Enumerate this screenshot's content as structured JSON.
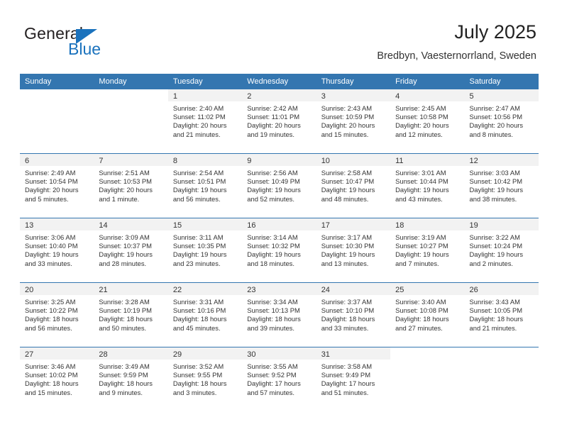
{
  "brand": {
    "name_part1": "General",
    "name_part2": "Blue"
  },
  "header": {
    "title": "July 2025",
    "subtitle": "Bredbyn, Vaesternorrland, Sweden"
  },
  "colors": {
    "header_blue": "#3476b0",
    "logo_blue": "#1a72bd",
    "daynum_band": "#f2f2f2",
    "text": "#333333"
  },
  "weekdays": [
    "Sunday",
    "Monday",
    "Tuesday",
    "Wednesday",
    "Thursday",
    "Friday",
    "Saturday"
  ],
  "weeks": [
    [
      {
        "day": "",
        "sunrise": "",
        "sunset": "",
        "daylight_line1": "",
        "daylight_line2": ""
      },
      {
        "day": "",
        "sunrise": "",
        "sunset": "",
        "daylight_line1": "",
        "daylight_line2": ""
      },
      {
        "day": "1",
        "sunrise": "Sunrise: 2:40 AM",
        "sunset": "Sunset: 11:02 PM",
        "daylight_line1": "Daylight: 20 hours",
        "daylight_line2": "and 21 minutes."
      },
      {
        "day": "2",
        "sunrise": "Sunrise: 2:42 AM",
        "sunset": "Sunset: 11:01 PM",
        "daylight_line1": "Daylight: 20 hours",
        "daylight_line2": "and 19 minutes."
      },
      {
        "day": "3",
        "sunrise": "Sunrise: 2:43 AM",
        "sunset": "Sunset: 10:59 PM",
        "daylight_line1": "Daylight: 20 hours",
        "daylight_line2": "and 15 minutes."
      },
      {
        "day": "4",
        "sunrise": "Sunrise: 2:45 AM",
        "sunset": "Sunset: 10:58 PM",
        "daylight_line1": "Daylight: 20 hours",
        "daylight_line2": "and 12 minutes."
      },
      {
        "day": "5",
        "sunrise": "Sunrise: 2:47 AM",
        "sunset": "Sunset: 10:56 PM",
        "daylight_line1": "Daylight: 20 hours",
        "daylight_line2": "and 8 minutes."
      }
    ],
    [
      {
        "day": "6",
        "sunrise": "Sunrise: 2:49 AM",
        "sunset": "Sunset: 10:54 PM",
        "daylight_line1": "Daylight: 20 hours",
        "daylight_line2": "and 5 minutes."
      },
      {
        "day": "7",
        "sunrise": "Sunrise: 2:51 AM",
        "sunset": "Sunset: 10:53 PM",
        "daylight_line1": "Daylight: 20 hours",
        "daylight_line2": "and 1 minute."
      },
      {
        "day": "8",
        "sunrise": "Sunrise: 2:54 AM",
        "sunset": "Sunset: 10:51 PM",
        "daylight_line1": "Daylight: 19 hours",
        "daylight_line2": "and 56 minutes."
      },
      {
        "day": "9",
        "sunrise": "Sunrise: 2:56 AM",
        "sunset": "Sunset: 10:49 PM",
        "daylight_line1": "Daylight: 19 hours",
        "daylight_line2": "and 52 minutes."
      },
      {
        "day": "10",
        "sunrise": "Sunrise: 2:58 AM",
        "sunset": "Sunset: 10:47 PM",
        "daylight_line1": "Daylight: 19 hours",
        "daylight_line2": "and 48 minutes."
      },
      {
        "day": "11",
        "sunrise": "Sunrise: 3:01 AM",
        "sunset": "Sunset: 10:44 PM",
        "daylight_line1": "Daylight: 19 hours",
        "daylight_line2": "and 43 minutes."
      },
      {
        "day": "12",
        "sunrise": "Sunrise: 3:03 AM",
        "sunset": "Sunset: 10:42 PM",
        "daylight_line1": "Daylight: 19 hours",
        "daylight_line2": "and 38 minutes."
      }
    ],
    [
      {
        "day": "13",
        "sunrise": "Sunrise: 3:06 AM",
        "sunset": "Sunset: 10:40 PM",
        "daylight_line1": "Daylight: 19 hours",
        "daylight_line2": "and 33 minutes."
      },
      {
        "day": "14",
        "sunrise": "Sunrise: 3:09 AM",
        "sunset": "Sunset: 10:37 PM",
        "daylight_line1": "Daylight: 19 hours",
        "daylight_line2": "and 28 minutes."
      },
      {
        "day": "15",
        "sunrise": "Sunrise: 3:11 AM",
        "sunset": "Sunset: 10:35 PM",
        "daylight_line1": "Daylight: 19 hours",
        "daylight_line2": "and 23 minutes."
      },
      {
        "day": "16",
        "sunrise": "Sunrise: 3:14 AM",
        "sunset": "Sunset: 10:32 PM",
        "daylight_line1": "Daylight: 19 hours",
        "daylight_line2": "and 18 minutes."
      },
      {
        "day": "17",
        "sunrise": "Sunrise: 3:17 AM",
        "sunset": "Sunset: 10:30 PM",
        "daylight_line1": "Daylight: 19 hours",
        "daylight_line2": "and 13 minutes."
      },
      {
        "day": "18",
        "sunrise": "Sunrise: 3:19 AM",
        "sunset": "Sunset: 10:27 PM",
        "daylight_line1": "Daylight: 19 hours",
        "daylight_line2": "and 7 minutes."
      },
      {
        "day": "19",
        "sunrise": "Sunrise: 3:22 AM",
        "sunset": "Sunset: 10:24 PM",
        "daylight_line1": "Daylight: 19 hours",
        "daylight_line2": "and 2 minutes."
      }
    ],
    [
      {
        "day": "20",
        "sunrise": "Sunrise: 3:25 AM",
        "sunset": "Sunset: 10:22 PM",
        "daylight_line1": "Daylight: 18 hours",
        "daylight_line2": "and 56 minutes."
      },
      {
        "day": "21",
        "sunrise": "Sunrise: 3:28 AM",
        "sunset": "Sunset: 10:19 PM",
        "daylight_line1": "Daylight: 18 hours",
        "daylight_line2": "and 50 minutes."
      },
      {
        "day": "22",
        "sunrise": "Sunrise: 3:31 AM",
        "sunset": "Sunset: 10:16 PM",
        "daylight_line1": "Daylight: 18 hours",
        "daylight_line2": "and 45 minutes."
      },
      {
        "day": "23",
        "sunrise": "Sunrise: 3:34 AM",
        "sunset": "Sunset: 10:13 PM",
        "daylight_line1": "Daylight: 18 hours",
        "daylight_line2": "and 39 minutes."
      },
      {
        "day": "24",
        "sunrise": "Sunrise: 3:37 AM",
        "sunset": "Sunset: 10:10 PM",
        "daylight_line1": "Daylight: 18 hours",
        "daylight_line2": "and 33 minutes."
      },
      {
        "day": "25",
        "sunrise": "Sunrise: 3:40 AM",
        "sunset": "Sunset: 10:08 PM",
        "daylight_line1": "Daylight: 18 hours",
        "daylight_line2": "and 27 minutes."
      },
      {
        "day": "26",
        "sunrise": "Sunrise: 3:43 AM",
        "sunset": "Sunset: 10:05 PM",
        "daylight_line1": "Daylight: 18 hours",
        "daylight_line2": "and 21 minutes."
      }
    ],
    [
      {
        "day": "27",
        "sunrise": "Sunrise: 3:46 AM",
        "sunset": "Sunset: 10:02 PM",
        "daylight_line1": "Daylight: 18 hours",
        "daylight_line2": "and 15 minutes."
      },
      {
        "day": "28",
        "sunrise": "Sunrise: 3:49 AM",
        "sunset": "Sunset: 9:59 PM",
        "daylight_line1": "Daylight: 18 hours",
        "daylight_line2": "and 9 minutes."
      },
      {
        "day": "29",
        "sunrise": "Sunrise: 3:52 AM",
        "sunset": "Sunset: 9:55 PM",
        "daylight_line1": "Daylight: 18 hours",
        "daylight_line2": "and 3 minutes."
      },
      {
        "day": "30",
        "sunrise": "Sunrise: 3:55 AM",
        "sunset": "Sunset: 9:52 PM",
        "daylight_line1": "Daylight: 17 hours",
        "daylight_line2": "and 57 minutes."
      },
      {
        "day": "31",
        "sunrise": "Sunrise: 3:58 AM",
        "sunset": "Sunset: 9:49 PM",
        "daylight_line1": "Daylight: 17 hours",
        "daylight_line2": "and 51 minutes."
      },
      {
        "day": "",
        "sunrise": "",
        "sunset": "",
        "daylight_line1": "",
        "daylight_line2": ""
      },
      {
        "day": "",
        "sunrise": "",
        "sunset": "",
        "daylight_line1": "",
        "daylight_line2": ""
      }
    ]
  ]
}
